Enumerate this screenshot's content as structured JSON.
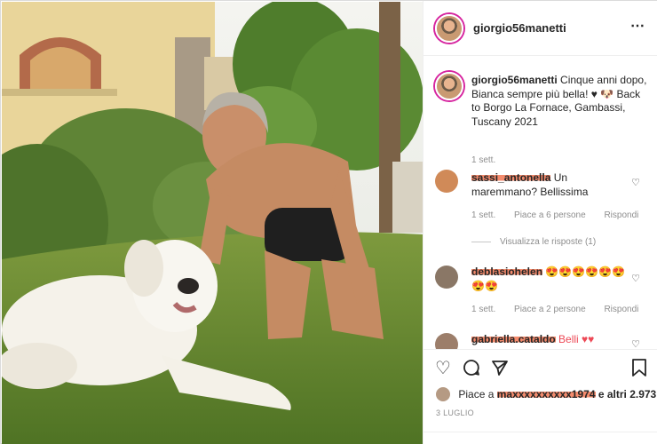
{
  "post": {
    "username": "giorgio56manetti",
    "more_icon": "⋯"
  },
  "caption": {
    "username": "giorgio56manetti",
    "text": "Cinque anni dopo, Bianca sempre più bella! ♥ 🐶 Back to Borgo La Fornace, Gambassi, Tuscany 2021",
    "age": "1 sett."
  },
  "comments": [
    {
      "username": "sassi_antonella",
      "text": "Un maremmano? Bellissima",
      "age": "1 sett.",
      "likes": "Piace a 6 persone",
      "reply": "Rispondi",
      "view_replies": "Visualizza le risposte (1)"
    },
    {
      "username": "deblasiohelen",
      "text": "😍😍😍😍😍😍😍😍",
      "age": "1 sett.",
      "likes": "Piace a 2 persone",
      "reply": "Rispondi"
    },
    {
      "username": "gabriella.cataldo",
      "text": "Belli ♥♥"
    }
  ],
  "actions": {
    "like_icon": "heart-icon",
    "comment_icon": "comment-icon",
    "share_icon": "send-icon",
    "save_icon": "bookmark-icon"
  },
  "likes": {
    "prefix": "Piace a",
    "user": "maxxxxxxxxxx1974",
    "suffix": "e altri 2.973"
  },
  "date": "3 LUGLIO",
  "colors": {
    "scribble": "#f0643c",
    "story_ring": "#d6249f",
    "meta": "#8e8e8e"
  }
}
